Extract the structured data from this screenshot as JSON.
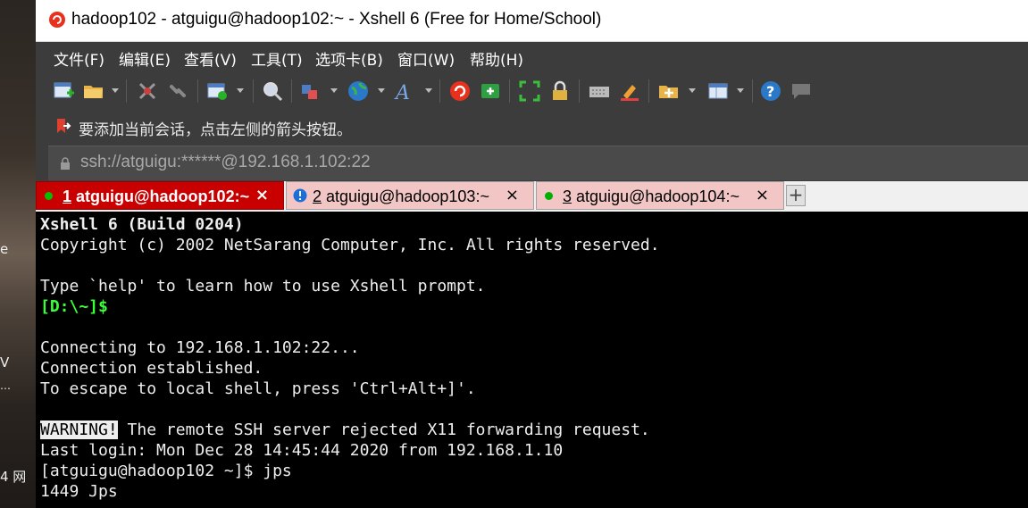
{
  "desktop": {
    "fragments": [
      "e",
      "V",
      "4 网",
      "…"
    ]
  },
  "window": {
    "title": "hadoop102 - atguigu@hadoop102:~ - Xshell 6 (Free for Home/School)"
  },
  "menu": [
    "文件(F)",
    "编辑(E)",
    "查看(V)",
    "工具(T)",
    "选项卡(B)",
    "窗口(W)",
    "帮助(H)"
  ],
  "toolbar": {
    "icons": [
      "new-session-icon",
      "open-folder-icon",
      "disconnect-icon",
      "reconnect-icon",
      "new-window-icon",
      "find-icon",
      "transfer-icon",
      "globe-icon",
      "font-icon",
      "xshell-icon",
      "xftp-icon",
      "fullscreen-icon",
      "lock-icon",
      "keyboard-icon",
      "highlight-icon",
      "add-folder-icon",
      "layout-icon",
      "help-icon",
      "chat-icon"
    ]
  },
  "hint": {
    "text": "要添加当前会话，点击左侧的箭头按钮。"
  },
  "address": {
    "text": "ssh://atguigu:******@192.168.1.102:22"
  },
  "tabs": [
    {
      "num": "1",
      "label": " atguigu@hadoop102:~",
      "close": "×",
      "status_color": "#00c000"
    },
    {
      "num": "2",
      "label": " atguigu@hadoop103:~",
      "close": "×",
      "status_color": "#1a6fd8"
    },
    {
      "num": "3",
      "label": " atguigu@hadoop104:~",
      "close": "×",
      "status_color": "#00b000"
    }
  ],
  "tab_add": "+",
  "terminal": {
    "lines": [
      "Xshell 6 (Build 0204)",
      "Copyright (c) 2002 NetSarang Computer, Inc. All rights reserved.",
      "",
      "Type `help' to learn how to use Xshell prompt.",
      "[D:\\~]$",
      "",
      "Connecting to 192.168.1.102:22...",
      "Connection established.",
      "To escape to local shell, press 'Ctrl+Alt+]'.",
      "",
      "The remote SSH server rejected X11 forwarding request.",
      "Last login: Mon Dec 28 14:45:44 2020 from 192.168.1.10",
      "[atguigu@hadoop102 ~]$ jps",
      "1449 Jps"
    ],
    "warning_label": "WARNING!"
  },
  "colors": {
    "active_tab": "#c80000",
    "inactive_tab": "#f3c6c6",
    "prompt_green": "#38ff38"
  }
}
